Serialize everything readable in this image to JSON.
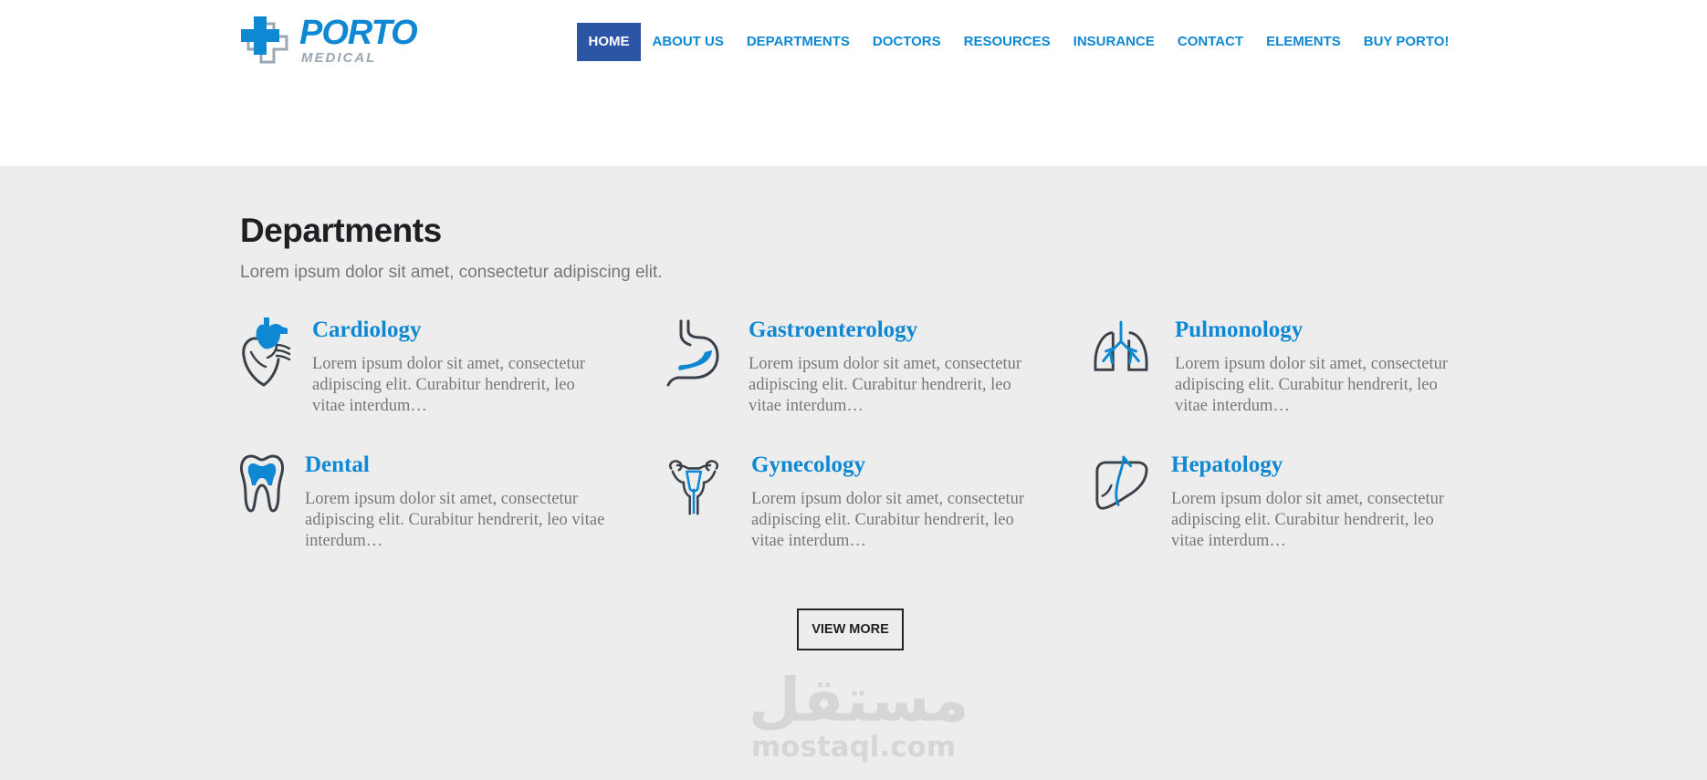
{
  "logo": {
    "name": "PORTO",
    "tagline": "MEDICAL",
    "icon": "medical-cross-icon"
  },
  "nav": {
    "items": [
      {
        "label": "HOME",
        "active": true
      },
      {
        "label": "ABOUT US"
      },
      {
        "label": "DEPARTMENTS"
      },
      {
        "label": "DOCTORS"
      },
      {
        "label": "RESOURCES"
      },
      {
        "label": "INSURANCE"
      },
      {
        "label": "CONTACT"
      },
      {
        "label": "ELEMENTS"
      },
      {
        "label": "BUY PORTO!"
      }
    ]
  },
  "section": {
    "title": "Departments",
    "subtitle": "Lorem ipsum dolor sit amet, consectetur adipiscing elit.",
    "departments": [
      {
        "title": "Cardiology",
        "icon": "heart-icon",
        "text": "Lorem ipsum dolor sit amet, consectetur adipiscing elit. Curabitur hendrerit, leo vitae interdum…"
      },
      {
        "title": "Gastroenterology",
        "icon": "stomach-icon",
        "text": "Lorem ipsum dolor sit amet, consectetur adipiscing elit. Curabitur hendrerit, leo vitae interdum…"
      },
      {
        "title": "Pulmonology",
        "icon": "lungs-icon",
        "text": "Lorem ipsum dolor sit amet, consectetur adipiscing elit. Curabitur hendrerit, leo vitae interdum…"
      },
      {
        "title": "Dental",
        "icon": "tooth-icon",
        "text": "Lorem ipsum dolor sit amet, consectetur adipiscing elit. Curabitur hendrerit, leo vitae interdum…"
      },
      {
        "title": "Gynecology",
        "icon": "uterus-icon",
        "text": "Lorem ipsum dolor sit amet, consectetur adipiscing elit. Curabitur hendrerit, leo vitae interdum…"
      },
      {
        "title": "Hepatology",
        "icon": "liver-icon",
        "text": "Lorem ipsum dolor sit amet, consectetur adipiscing elit. Curabitur hendrerit, leo vitae interdum…"
      }
    ],
    "view_more": "VIEW MORE"
  },
  "watermark": {
    "arabic": "مستقل",
    "latin": "mostaql.com"
  },
  "colors": {
    "accent": "#0e88d3",
    "nav_active_bg": "#2c55a5",
    "section_bg": "#ededed",
    "icon_dark": "#3a4149",
    "text_gray": "#777777"
  }
}
